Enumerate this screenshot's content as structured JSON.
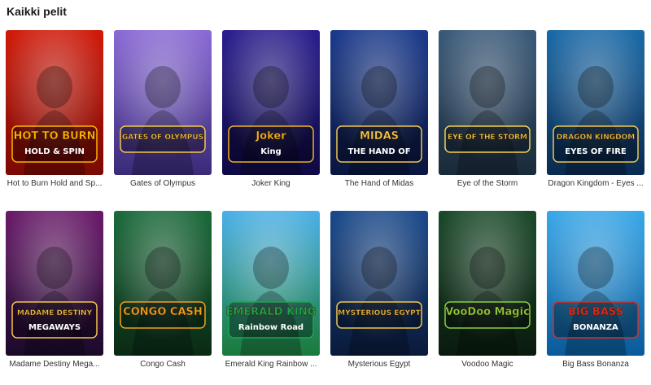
{
  "section": {
    "title": "Kaikki pelit"
  },
  "games": [
    {
      "caption": "Hot to Burn Hold and Sp...",
      "art_title": "HOT TO BURN",
      "art_sub": "HOLD & SPIN",
      "bg1": "#d01a0a",
      "bg2": "#7a0a04",
      "accent": "#ffb400"
    },
    {
      "caption": "Gates of Olympus",
      "art_title": "GATES OF OLYMPUS",
      "art_sub": "",
      "bg1": "#8a6ad6",
      "bg2": "#3a2a78",
      "accent": "#f2c64a"
    },
    {
      "caption": "Joker King",
      "art_title": "Joker",
      "art_sub": "King",
      "bg1": "#2a1e8e",
      "bg2": "#0e0a44",
      "accent": "#f0b21a"
    },
    {
      "caption": "The Hand of Midas",
      "art_title": "MIDAS",
      "art_sub": "THE HAND OF",
      "bg1": "#1a3a8c",
      "bg2": "#0a1640",
      "accent": "#f2c64a"
    },
    {
      "caption": "Eye of the Storm",
      "art_title": "EYE OF THE STORM",
      "art_sub": "",
      "bg1": "#3a5a7a",
      "bg2": "#1a2a3a",
      "accent": "#f2d04a"
    },
    {
      "caption": "Dragon Kingdom - Eyes ...",
      "art_title": "DRAGON KINGDOM",
      "art_sub": "EYES OF FIRE",
      "bg1": "#1a6aa8",
      "bg2": "#0a2a50",
      "accent": "#f2c64a"
    },
    {
      "caption": "Madame Destiny Mega...",
      "art_title": "MADAME DESTINY",
      "art_sub": "MEGAWAYS",
      "bg1": "#6a1a6a",
      "bg2": "#1a0a2a",
      "accent": "#f2c64a"
    },
    {
      "caption": "Congo Cash",
      "art_title": "CONGO CASH",
      "art_sub": "",
      "bg1": "#1a6a3a",
      "bg2": "#0a2a14",
      "accent": "#f2a01a"
    },
    {
      "caption": "Emerald King Rainbow ...",
      "art_title": "EMERALD KING",
      "art_sub": "Rainbow Road",
      "bg1": "#4ab0e8",
      "bg2": "#1a7a3a",
      "accent": "#1aa84a"
    },
    {
      "caption": "Mysterious Egypt",
      "art_title": "MYSTERIOUS EGYPT",
      "art_sub": "",
      "bg1": "#1a4a8c",
      "bg2": "#0a1a3a",
      "accent": "#f2c64a"
    },
    {
      "caption": "Voodoo Magic",
      "art_title": "VooDoo Magic",
      "art_sub": "",
      "bg1": "#1a4a2a",
      "bg2": "#0a1a0e",
      "accent": "#8ad03a"
    },
    {
      "caption": "Big Bass Bonanza",
      "art_title": "BIG BASS",
      "art_sub": "BONANZA",
      "bg1": "#3aa8e8",
      "bg2": "#0a5a9a",
      "accent": "#e8281a"
    }
  ]
}
